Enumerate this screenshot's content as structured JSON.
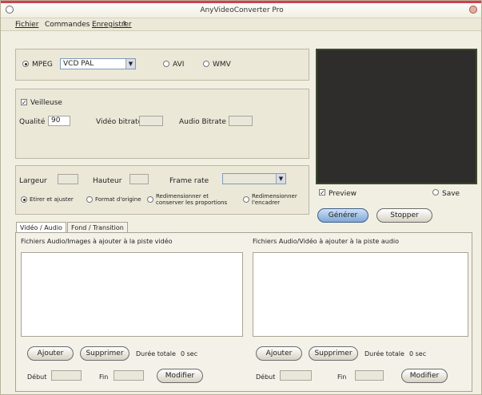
{
  "window": {
    "title": "AnyVideoConverter Pro"
  },
  "menu": [
    "Fichier",
    "Commandes",
    "Enregistrer",
    "?"
  ],
  "format": {
    "options": [
      "MPEG",
      "AVI",
      "WMV"
    ],
    "selected": "VCD PAL"
  },
  "quality": {
    "checkbox_label": "Veilleuse",
    "quality_label": "Qualité",
    "quality_value": "90",
    "video_bitrate_label": "Vidéo bitrate",
    "audio_bitrate_label": "Audio Bitrate"
  },
  "size": {
    "width_label": "Largeur",
    "height_label": "Hauteur",
    "framerate_label": "Frame rate",
    "options": [
      "Etirer et ajuster",
      "Format d'origine",
      "Redimensionner et conserver les proportions",
      "Redimensionner l'encadrer"
    ]
  },
  "preview": {
    "preview_label": "Preview",
    "save_label": "Save",
    "generate_label": "Générer",
    "stop_label": "Stopper"
  },
  "tabs": [
    "Vidéo / Audio",
    "Fond / Transition"
  ],
  "video_pane": {
    "title": "Fichiers Audio/Images à ajouter à la piste vidéo",
    "add": "Ajouter",
    "remove": "Supprimer",
    "total_label": "Durée totale",
    "total_value": "0 sec",
    "start_label": "Début",
    "end_label": "Fin",
    "modify": "Modifier"
  },
  "audio_pane": {
    "title": "Fichiers Audio/Vidéo à ajouter à la piste audio",
    "add": "Ajouter",
    "remove": "Supprimer",
    "total_label": "Durée totale",
    "total_value": "0 sec",
    "start_label": "Début",
    "end_label": "Fin",
    "modify": "Modifier"
  }
}
